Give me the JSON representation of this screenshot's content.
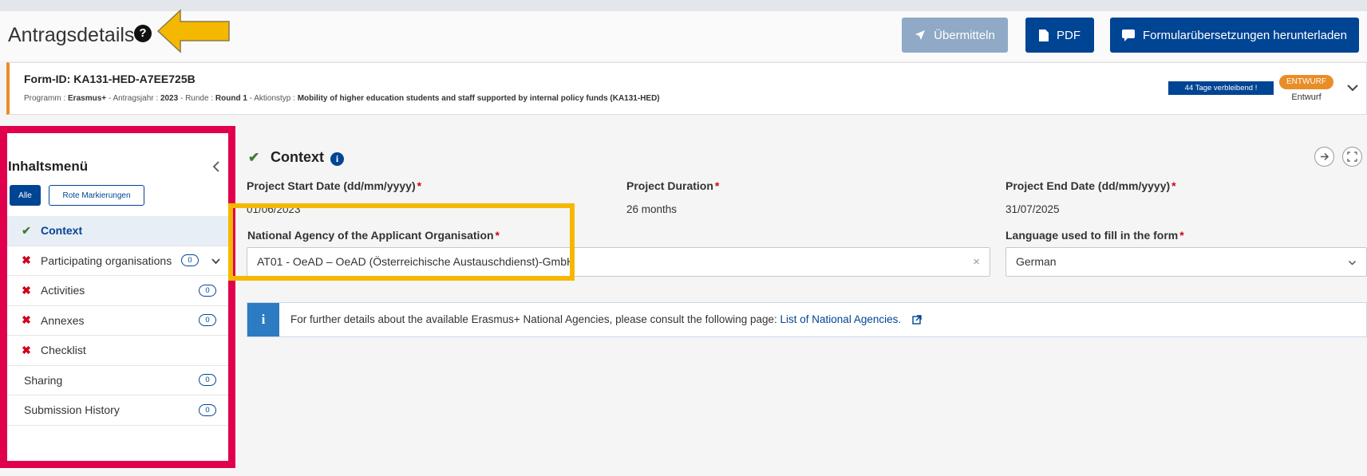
{
  "header": {
    "title": "Antragsdetails",
    "help_glyph": "?",
    "buttons": {
      "submit": "Übermitteln",
      "pdf": "PDF",
      "translate": "Formularübersetzungen herunterladen"
    }
  },
  "form": {
    "id_label": "Form-ID: KA131-HED-A7EE725B",
    "meta": {
      "program_key": "Programm :",
      "program_val": "Erasmus+",
      "year_key": "Antragsjahr :",
      "year_val": "2023",
      "round_key": "Runde :",
      "round_val": "Round 1",
      "action_key": "Aktionstyp :",
      "action_val": "Mobility of higher education students and staff supported by internal policy funds (KA131-HED)"
    },
    "days_left": "44 Tage verbleibend !",
    "status_badge": "ENTWURF",
    "status_text": "Entwurf"
  },
  "sidebar": {
    "title": "Inhaltsmenü",
    "filter_all": "Alle",
    "filter_red": "Rote Markierungen",
    "items": [
      {
        "label": "Context",
        "count": ""
      },
      {
        "label": "Participating organisations",
        "count": "0"
      },
      {
        "label": "Activities",
        "count": "0"
      },
      {
        "label": "Annexes",
        "count": "0"
      },
      {
        "label": "Checklist",
        "count": ""
      },
      {
        "label": "Sharing",
        "count": "0"
      },
      {
        "label": "Submission History",
        "count": "0"
      }
    ]
  },
  "context": {
    "title": "Context",
    "info_glyph": "i",
    "start_label": "Project Start Date (dd/mm/yyyy)",
    "start_value": "01/06/2023",
    "duration_label": "Project Duration",
    "duration_value": "26 months",
    "end_label": "Project End Date (dd/mm/yyyy)",
    "end_value": "31/07/2025",
    "agency_label": "National Agency of the Applicant Organisation",
    "agency_value": "AT01 - OeAD – OeAD (Österreichische Austauschdienst)-GmbH",
    "language_label": "Language used to fill in the form",
    "language_value": "German",
    "required_mark": "*",
    "clear_glyph": "×",
    "info_text": "For further details about the available Erasmus+ National Agencies, please consult the following page:",
    "info_link": "List of National Agencies."
  },
  "colors": {
    "primary": "#004494",
    "draft_orange": "#e98d27",
    "highlight_red": "#e0004d",
    "highlight_yellow": "#f5b800",
    "success_green": "#467a39",
    "error_red": "#d0021b"
  },
  "icons": [
    "help-icon",
    "arrow-annotation",
    "send-icon",
    "file-icon",
    "comment-icon",
    "chevron-down-icon",
    "chevron-left-icon",
    "check-icon",
    "cross-icon",
    "info-icon",
    "arrow-right-icon",
    "expand-icon",
    "clear-icon",
    "external-link-icon"
  ]
}
